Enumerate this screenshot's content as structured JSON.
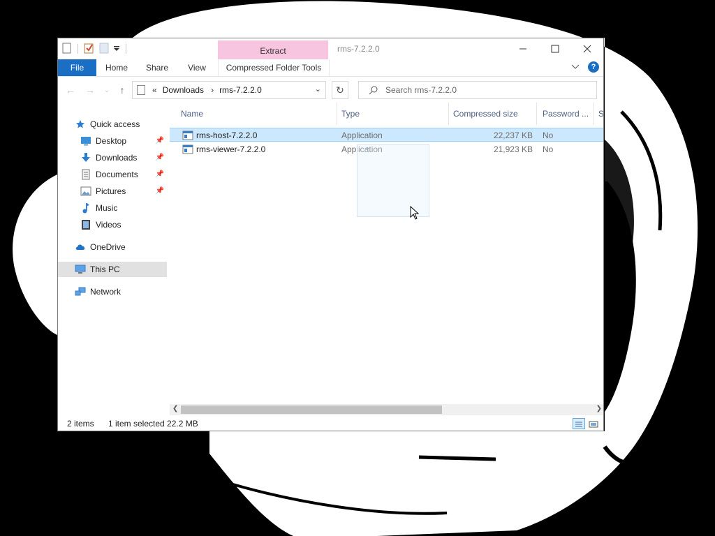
{
  "window": {
    "title": "rms-7.2.2.0",
    "contextual_tab_group": "Extract"
  },
  "ribbon": {
    "tabs": [
      {
        "label": "File"
      },
      {
        "label": "Home"
      },
      {
        "label": "Share"
      },
      {
        "label": "View"
      },
      {
        "label": "Compressed Folder Tools"
      }
    ]
  },
  "navigation": {
    "breadcrumb": [
      "Downloads",
      "rms-7.2.2.0"
    ],
    "search_placeholder": "Search rms-7.2.2.0"
  },
  "nav_pane": {
    "items": [
      {
        "label": "Quick access",
        "icon": "star-icon"
      },
      {
        "label": "Desktop",
        "icon": "desktop-icon",
        "pinned": true
      },
      {
        "label": "Downloads",
        "icon": "download-arrow-icon",
        "pinned": true
      },
      {
        "label": "Documents",
        "icon": "documents-icon",
        "pinned": true
      },
      {
        "label": "Pictures",
        "icon": "pictures-icon",
        "pinned": true
      },
      {
        "label": "Music",
        "icon": "music-note-icon"
      },
      {
        "label": "Videos",
        "icon": "videos-icon"
      },
      {
        "label": "OneDrive",
        "icon": "cloud-icon"
      },
      {
        "label": "This PC",
        "icon": "computer-icon",
        "selected": true
      },
      {
        "label": "Network",
        "icon": "network-icon"
      }
    ]
  },
  "file_list": {
    "columns": [
      "Name",
      "Type",
      "Compressed size",
      "Password ...",
      "Si"
    ],
    "rows": [
      {
        "name": "rms-host-7.2.2.0",
        "type": "Application",
        "compressed_size": "22,237 KB",
        "password": "No",
        "selected": true
      },
      {
        "name": "rms-viewer-7.2.2.0",
        "type": "Application",
        "compressed_size": "21,923 KB",
        "password": "No",
        "selected": false
      }
    ]
  },
  "status_bar": {
    "item_count": "2 items",
    "selection": "1 item selected  22.2 MB"
  },
  "colors": {
    "file_tab": "#1a6fc4",
    "contextual_tab": "#f8c5e0",
    "selection": "#cce8ff"
  }
}
